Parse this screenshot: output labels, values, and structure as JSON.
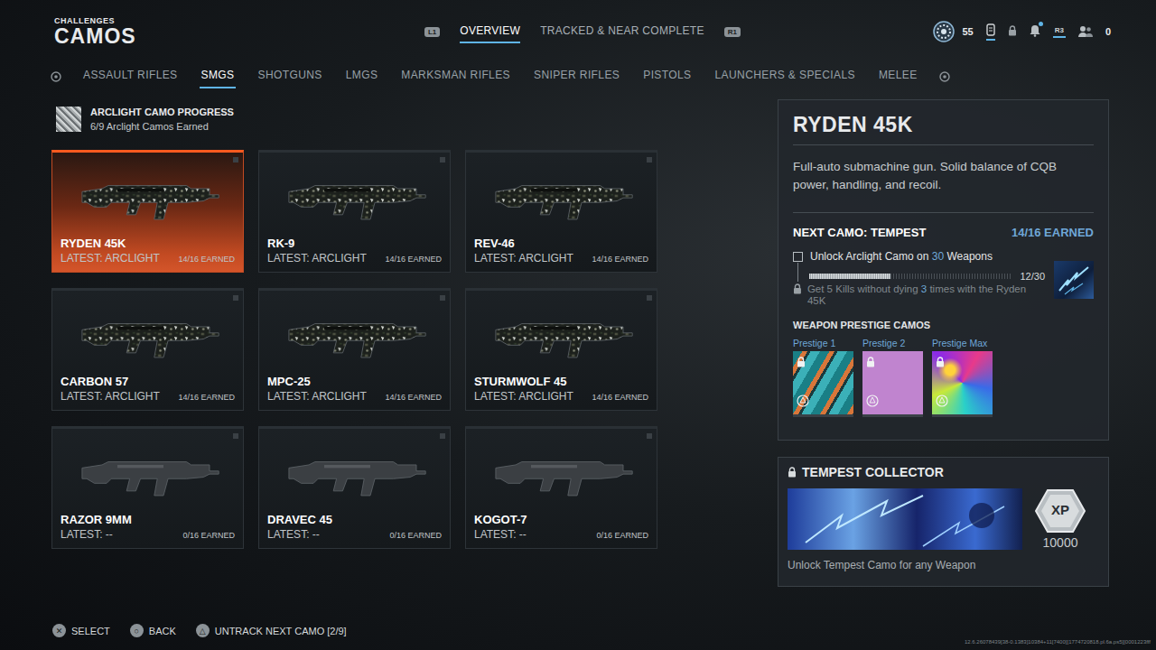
{
  "header": {
    "kicker": "CHALLENGES",
    "title": "CAMOS"
  },
  "top_tabs": {
    "prev_key": "L1",
    "next_key": "R1",
    "items": [
      {
        "label": "OVERVIEW",
        "selected": true
      },
      {
        "label": "TRACKED & NEAR COMPLETE",
        "selected": false
      }
    ]
  },
  "status": {
    "level": "55",
    "notification_dot": true,
    "key_hint": "R3",
    "count": "0"
  },
  "categories": [
    {
      "label": "ASSAULT RIFLES",
      "selected": false
    },
    {
      "label": "SMGS",
      "selected": true
    },
    {
      "label": "SHOTGUNS",
      "selected": false
    },
    {
      "label": "LMGS",
      "selected": false
    },
    {
      "label": "MARKSMAN RIFLES",
      "selected": false
    },
    {
      "label": "SNIPER RIFLES",
      "selected": false
    },
    {
      "label": "PISTOLS",
      "selected": false
    },
    {
      "label": "LAUNCHERS & SPECIALS",
      "selected": false
    },
    {
      "label": "MELEE",
      "selected": false
    }
  ],
  "progress": {
    "title": "ARCLIGHT CAMO PROGRESS",
    "subtitle": "6/9 Arclight Camos Earned"
  },
  "weapons": [
    {
      "name": "RYDEN 45K",
      "latest": "LATEST: ARCLIGHT",
      "earned": "14/16 EARNED",
      "selected": true,
      "camo_applied": true
    },
    {
      "name": "RK-9",
      "latest": "LATEST: ARCLIGHT",
      "earned": "14/16 EARNED",
      "selected": false,
      "camo_applied": true
    },
    {
      "name": "REV-46",
      "latest": "LATEST: ARCLIGHT",
      "earned": "14/16 EARNED",
      "selected": false,
      "camo_applied": true
    },
    {
      "name": "CARBON 57",
      "latest": "LATEST: ARCLIGHT",
      "earned": "14/16 EARNED",
      "selected": false,
      "camo_applied": true
    },
    {
      "name": "MPC-25",
      "latest": "LATEST: ARCLIGHT",
      "earned": "14/16 EARNED",
      "selected": false,
      "camo_applied": true
    },
    {
      "name": "STURMWOLF 45",
      "latest": "LATEST: ARCLIGHT",
      "earned": "14/16 EARNED",
      "selected": false,
      "camo_applied": true
    },
    {
      "name": "RAZOR 9MM",
      "latest": "LATEST: --",
      "earned": "0/16 EARNED",
      "selected": false,
      "camo_applied": false
    },
    {
      "name": "DRAVEC 45",
      "latest": "LATEST: --",
      "earned": "0/16 EARNED",
      "selected": false,
      "camo_applied": false
    },
    {
      "name": "KOGOT-7",
      "latest": "LATEST: --",
      "earned": "0/16 EARNED",
      "selected": false,
      "camo_applied": false
    }
  ],
  "detail": {
    "name": "RYDEN 45K",
    "description": "Full-auto submachine gun. Solid balance of CQB power, handling, and recoil.",
    "next_camo": "NEXT CAMO: TEMPEST",
    "earned": "14/16 EARNED",
    "challenge": {
      "checked": false,
      "parts": [
        {
          "text": "Unlock Arclight Camo on ",
          "highlight": false
        },
        {
          "text": "30",
          "highlight": true
        },
        {
          "text": " Weapons",
          "highlight": false
        }
      ],
      "progress_text": "12/30",
      "level": 0.4,
      "step_locked": true,
      "step_parts": [
        {
          "text": "Get 5 Kills without dying ",
          "highlight": false
        },
        {
          "text": "3",
          "highlight": true
        },
        {
          "text": " times with the Ryden 45K",
          "highlight": false
        }
      ]
    },
    "prestige": {
      "title": "WEAPON PRESTIGE CAMOS",
      "items": [
        {
          "label": "Prestige 1",
          "locked": true,
          "kind": "stripes"
        },
        {
          "label": "Prestige 2",
          "locked": true,
          "kind": "plain"
        },
        {
          "label": "Prestige Max",
          "locked": true,
          "kind": "swirl"
        }
      ]
    }
  },
  "collector": {
    "title": "TEMPEST COLLECTOR",
    "locked": true,
    "xp_label": "XP",
    "xp": "10000",
    "description": "Unlock Tempest Camo for any Weapon"
  },
  "footer": {
    "actions": [
      {
        "glyph": "✕",
        "label": "SELECT"
      },
      {
        "glyph": "○",
        "label": "BACK"
      },
      {
        "glyph": "△",
        "label": "UNTRACK NEXT CAMO [2/9]"
      }
    ],
    "build": "12.6.26078439[38-0.1383]10384+11[7400][1774720818.pl.6a.ps5][0001223fff"
  }
}
